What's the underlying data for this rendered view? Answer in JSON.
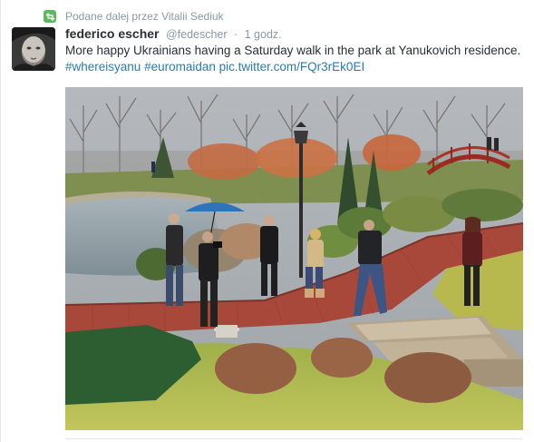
{
  "retweet": {
    "text": "Podane dalej przez Vitalii Sediuk",
    "icon": "retweet-icon"
  },
  "author": {
    "name": "federico escher",
    "handle": "@fedescher",
    "separator": "·",
    "time": "1 godz."
  },
  "tweet": {
    "text": "More happy Ukrainians having a Saturday walk in the park at Yanukovich residence.",
    "hashtags": [
      "#whereisyanu",
      "#euromaidan"
    ],
    "pic_link": "pic.twitter.com/FQr3rEk0EI"
  },
  "colors": {
    "link": "#2a7ab0",
    "name": "#292f33",
    "meta": "#8899a6",
    "retweet_green": "#5cb85c"
  }
}
